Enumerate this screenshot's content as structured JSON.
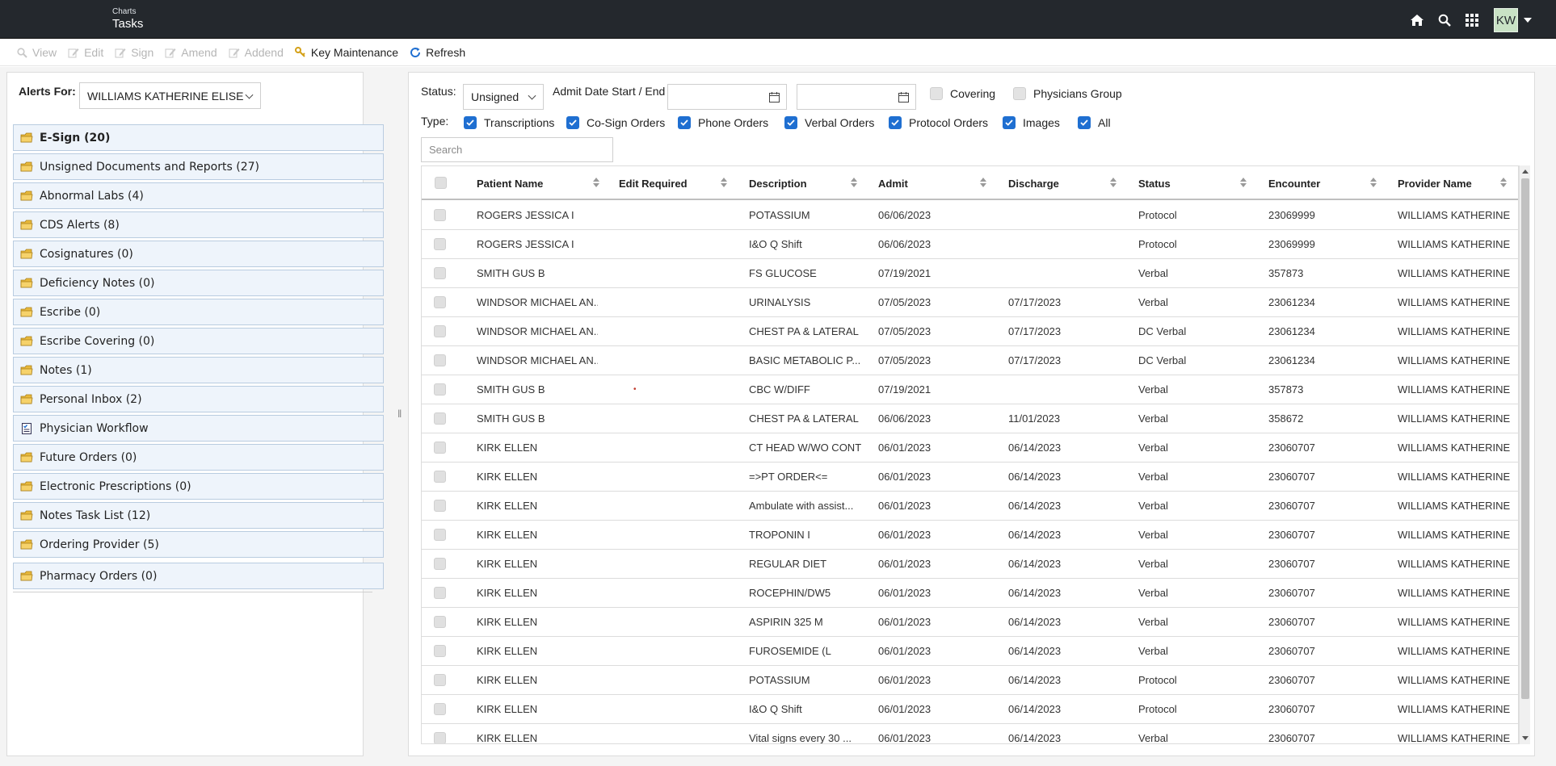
{
  "app": {
    "breadcrumb": "Charts",
    "title": "Tasks",
    "user_initials": "KW"
  },
  "topbar_icons": [
    "home-icon",
    "search-icon",
    "apps-grid-icon"
  ],
  "toolbar": {
    "view": "View",
    "edit": "Edit",
    "sign": "Sign",
    "amend": "Amend",
    "addend": "Addend",
    "key_maintenance": "Key Maintenance",
    "refresh": "Refresh"
  },
  "alerts": {
    "label": "Alerts For:",
    "selected": "WILLIAMS KATHERINE ELISE",
    "folders": [
      {
        "label": "E-Sign (20)",
        "icon": "folder-icon",
        "bold": true
      },
      {
        "label": "Unsigned Documents and Reports (27)",
        "icon": "folder-icon"
      },
      {
        "label": "Abnormal Labs (4)",
        "icon": "folder-icon"
      },
      {
        "label": "CDS Alerts (8)",
        "icon": "folder-icon"
      },
      {
        "label": "Cosignatures (0)",
        "icon": "folder-icon"
      },
      {
        "label": "Deficiency Notes (0)",
        "icon": "folder-icon"
      },
      {
        "label": "Escribe (0)",
        "icon": "folder-icon"
      },
      {
        "label": "Escribe Covering (0)",
        "icon": "folder-icon"
      },
      {
        "label": "Notes (1)",
        "icon": "folder-icon"
      },
      {
        "label": "Personal Inbox (2)",
        "icon": "folder-icon"
      },
      {
        "label": "Physician Workflow",
        "icon": "checklist-icon"
      },
      {
        "label": "Future Orders (0)",
        "icon": "folder-icon"
      },
      {
        "label": "Electronic Prescriptions (0)",
        "icon": "folder-icon"
      },
      {
        "label": "Notes Task List (12)",
        "icon": "folder-icon"
      },
      {
        "label": "Ordering Provider (5)",
        "icon": "folder-icon"
      },
      {
        "label": "Pharmacy Orders (0)",
        "icon": "folder-icon"
      }
    ]
  },
  "filters": {
    "status_label": "Status:",
    "status_value": "Unsigned",
    "admit_label": "Admit Date Start / End",
    "covering": "Covering",
    "physicians_group": "Physicians Group",
    "type_label": "Type:",
    "types": [
      {
        "label": "Transcriptions",
        "checked": true
      },
      {
        "label": "Co-Sign Orders",
        "checked": true
      },
      {
        "label": "Phone Orders",
        "checked": true
      },
      {
        "label": "Verbal Orders",
        "checked": true
      },
      {
        "label": "Protocol Orders",
        "checked": true
      },
      {
        "label": "Images",
        "checked": true
      },
      {
        "label": "All",
        "checked": true
      }
    ],
    "search_placeholder": "Search"
  },
  "grid": {
    "columns": [
      "Patient Name",
      "Edit Required",
      "Description",
      "Admit",
      "Discharge",
      "Status",
      "Encounter",
      "Provider Name"
    ],
    "rows": [
      [
        "ROGERS JESSICA I",
        "",
        "POTASSIUM",
        "06/06/2023",
        "",
        "Protocol",
        "23069999",
        "WILLIAMS KATHERINE"
      ],
      [
        "ROGERS JESSICA I",
        "",
        "I&O Q Shift",
        "06/06/2023",
        "",
        "Protocol",
        "23069999",
        "WILLIAMS KATHERINE"
      ],
      [
        "SMITH GUS B",
        "",
        "FS GLUCOSE",
        "07/19/2021",
        "",
        "Verbal",
        "357873",
        "WILLIAMS KATHERINE"
      ],
      [
        "WINDSOR MICHAEL AN...",
        "",
        "URINALYSIS",
        "07/05/2023",
        "07/17/2023",
        "Verbal",
        "23061234",
        "WILLIAMS KATHERINE"
      ],
      [
        "WINDSOR MICHAEL AN...",
        "",
        "CHEST PA & LATERAL",
        "07/05/2023",
        "07/17/2023",
        "DC Verbal",
        "23061234",
        "WILLIAMS KATHERINE"
      ],
      [
        "WINDSOR MICHAEL AN...",
        "",
        "BASIC METABOLIC P...",
        "07/05/2023",
        "07/17/2023",
        "DC Verbal",
        "23061234",
        "WILLIAMS KATHERINE"
      ],
      [
        "SMITH GUS B",
        "•",
        "CBC W/DIFF",
        "07/19/2021",
        "",
        "Verbal",
        "357873",
        "WILLIAMS KATHERINE"
      ],
      [
        "SMITH GUS B",
        "",
        "CHEST PA & LATERAL",
        "06/06/2023",
        "11/01/2023",
        "Verbal",
        "358672",
        "WILLIAMS KATHERINE"
      ],
      [
        "KIRK ELLEN",
        "",
        "CT HEAD W/WO CONT",
        "06/01/2023",
        "06/14/2023",
        "Verbal",
        "23060707",
        "WILLIAMS KATHERINE"
      ],
      [
        "KIRK ELLEN",
        "",
        "=>PT ORDER<=",
        "06/01/2023",
        "06/14/2023",
        "Verbal",
        "23060707",
        "WILLIAMS KATHERINE"
      ],
      [
        "KIRK ELLEN",
        "",
        "Ambulate with assist...",
        "06/01/2023",
        "06/14/2023",
        "Verbal",
        "23060707",
        "WILLIAMS KATHERINE"
      ],
      [
        "KIRK ELLEN",
        "",
        "TROPONIN I",
        "06/01/2023",
        "06/14/2023",
        "Verbal",
        "23060707",
        "WILLIAMS KATHERINE"
      ],
      [
        "KIRK ELLEN",
        "",
        "REGULAR DIET",
        "06/01/2023",
        "06/14/2023",
        "Verbal",
        "23060707",
        "WILLIAMS KATHERINE"
      ],
      [
        "KIRK ELLEN",
        "",
        "ROCEPHIN/DW5",
        "06/01/2023",
        "06/14/2023",
        "Verbal",
        "23060707",
        "WILLIAMS KATHERINE"
      ],
      [
        "KIRK ELLEN",
        "",
        "ASPIRIN 325 M",
        "06/01/2023",
        "06/14/2023",
        "Verbal",
        "23060707",
        "WILLIAMS KATHERINE"
      ],
      [
        "KIRK ELLEN",
        "",
        "FUROSEMIDE (L",
        "06/01/2023",
        "06/14/2023",
        "Verbal",
        "23060707",
        "WILLIAMS KATHERINE"
      ],
      [
        "KIRK ELLEN",
        "",
        "POTASSIUM",
        "06/01/2023",
        "06/14/2023",
        "Protocol",
        "23060707",
        "WILLIAMS KATHERINE"
      ],
      [
        "KIRK ELLEN",
        "",
        "I&O Q Shift",
        "06/01/2023",
        "06/14/2023",
        "Protocol",
        "23060707",
        "WILLIAMS KATHERINE"
      ],
      [
        "KIRK ELLEN",
        "",
        "Vital signs every 30 ...",
        "06/01/2023",
        "06/14/2023",
        "Verbal",
        "23060707",
        "WILLIAMS KATHERINE"
      ]
    ]
  },
  "colors": {
    "topbar": "#24282d",
    "accent": "#1f6fd1",
    "folder_bg": "#eef4fb",
    "folder_border": "#b9cce0"
  }
}
